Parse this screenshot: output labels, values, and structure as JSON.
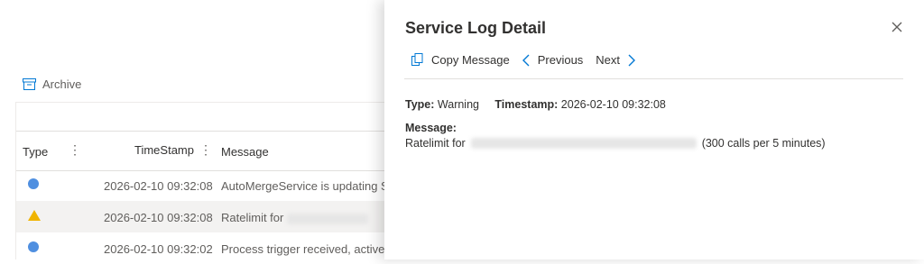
{
  "list": {
    "archive_label": "Archive",
    "columns": {
      "type": "Type",
      "timestamp": "TimeStamp",
      "message": "Message"
    },
    "rows": [
      {
        "type": "info",
        "timestamp": "2026-02-10 09:32:08",
        "message": "AutoMergeService is updating S"
      },
      {
        "type": "warning",
        "timestamp": "2026-02-10 09:32:08",
        "message": "Ratelimit for"
      },
      {
        "type": "info",
        "timestamp": "2026-02-10 09:32:02",
        "message": "Process trigger received, active"
      }
    ]
  },
  "panel": {
    "title": "Service Log Detail",
    "toolbar": {
      "copy": "Copy Message",
      "previous": "Previous",
      "next": "Next"
    },
    "type_label": "Type:",
    "type_value": "Warning",
    "timestamp_label": "Timestamp:",
    "timestamp_value": "2026-02-10 09:32:08",
    "message_label": "Message:",
    "message_prefix": "Ratelimit for",
    "message_suffix": "(300 calls per 5 minutes)"
  },
  "colors": {
    "accent": "#0078d4",
    "info": "#4f8fe0",
    "warning": "#f0b400"
  }
}
